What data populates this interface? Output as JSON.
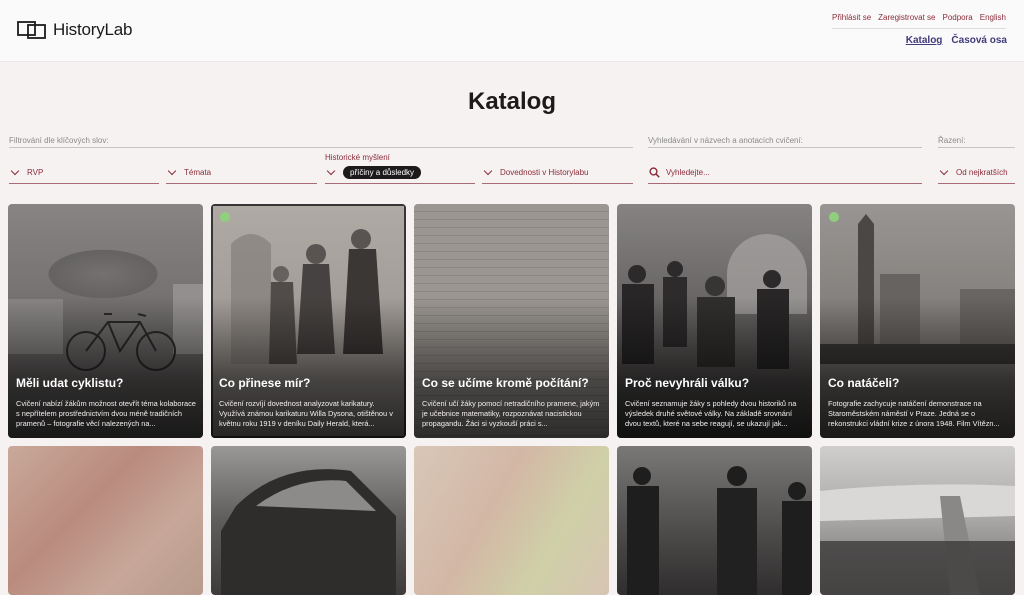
{
  "header": {
    "logo_text": "HistoryLab",
    "utility_links": [
      "Přihlásit se",
      "Zaregistrovat se",
      "Podpora",
      "English"
    ],
    "main_nav": [
      {
        "label": "Katalog",
        "active": true
      },
      {
        "label": "Časová osa",
        "active": false
      }
    ]
  },
  "page_title": "Katalog",
  "filters": {
    "keywords_label": "Filtrování dle klíčových slov:",
    "search_label": "Vyhledávání v názvech a anotacích cvičení:",
    "sort_label": "Řazení:",
    "rvp": "RVP",
    "topics": "Témata",
    "historical_thinking_label": "Historické myšlení",
    "historical_thinking_chip": "příčiny a důsledky",
    "skills": "Dovednosti v Historylabu",
    "search_placeholder": "Vyhledejte...",
    "sort_value": "Od nejkratších"
  },
  "cards": [
    {
      "title": "Měli udat cyklistu?",
      "desc": "Cvičení nabízí žákům možnost otevřít téma kolaborace s nepřítelem prostřednictvím dvou méně tradičních pramenů – fotografie věcí nalezených na...",
      "badge": false
    },
    {
      "title": "Co přinese mír?",
      "desc": "Cvičení rozvíjí dovednost analyzovat karikatury. Využívá známou karikaturu Willa Dysona, otištěnou v květnu roku 1919 v deníku Daily Herald, která...",
      "badge": true
    },
    {
      "title": "Co se učíme kromě počítání?",
      "desc": "Cvičení učí žáky pomocí netradičního pramene, jakým je učebnice matematiky, rozpoznávat nacistickou propagandu. Žáci si vyzkouší práci s...",
      "badge": false
    },
    {
      "title": "Proč nevyhráli válku?",
      "desc": "Cvičení seznamuje žáky s pohledy dvou historiků na výsledek druhé světové války. Na základě srovnání dvou textů, které na sebe reagují, se ukazují jak...",
      "badge": false
    },
    {
      "title": "Co natáčeli?",
      "desc": "Fotografie zachycuje natáčení demonstrace na Staroměstském náměstí v Praze. Jedná se o rekonstrukci vládní krize z února 1948. Film Vítězn...",
      "badge": true
    }
  ],
  "colors": {
    "accent": "#8b2b3a",
    "nav": "#3f3a7a",
    "bg": "#f6f2f2",
    "badge": "#8fcf7e"
  }
}
